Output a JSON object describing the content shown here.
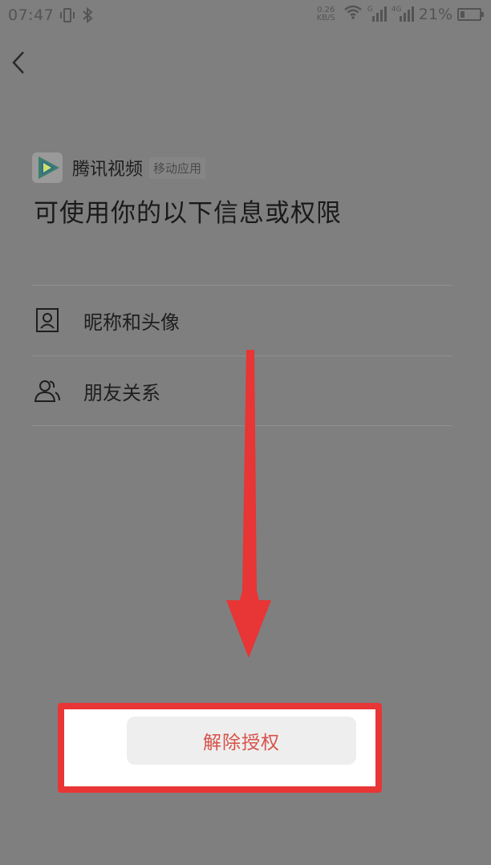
{
  "status_bar": {
    "time": "07:47",
    "net_speed_value": "0.26",
    "net_speed_unit": "KB/S",
    "network_label_1": "G",
    "network_label_2": "4G",
    "battery_percent": "21%",
    "battery_level": 0.21
  },
  "app": {
    "name": "腾讯视频",
    "tag": "移动应用"
  },
  "headline": "可使用你的以下信息或权限",
  "permissions": [
    {
      "label": "昵称和头像",
      "icon": "profile-card-icon"
    },
    {
      "label": "朋友关系",
      "icon": "friends-icon"
    }
  ],
  "action": {
    "revoke_label": "解除授权"
  },
  "colors": {
    "overlay_background": "#7f7f7f",
    "annotation_red": "#e83535",
    "revoke_text": "#d8524a"
  }
}
